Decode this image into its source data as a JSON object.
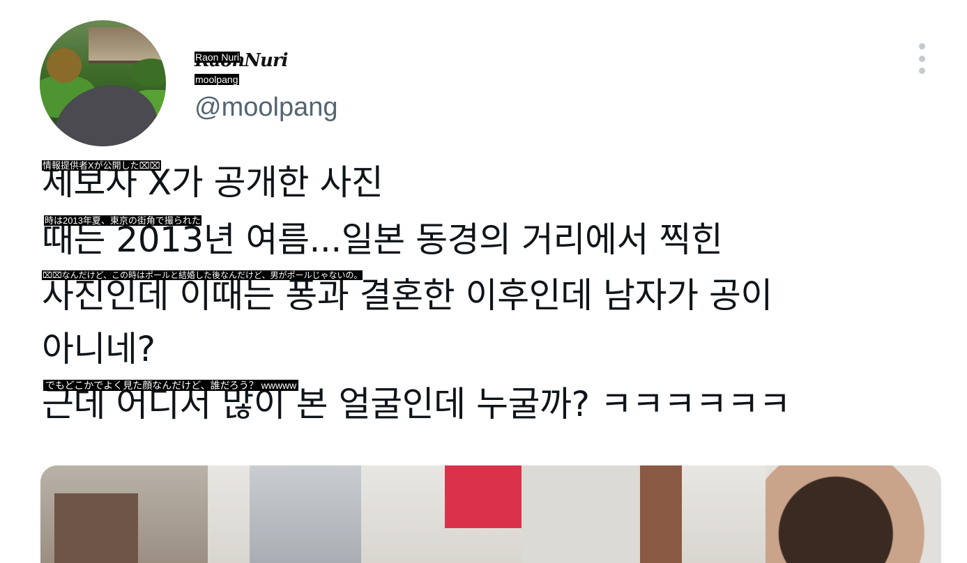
{
  "profile": {
    "avatar_icon": "garden-path-avatar",
    "display_name_script": "RaonNuri",
    "display_name_overlay": "Raon Nuri",
    "handle_overlay": "moolpang",
    "handle": "@moolpang",
    "more_icon": "vertical-ellipsis-icon"
  },
  "tweet": {
    "lines": [
      "제보자 X가 공개한 사진",
      "때는 2013년 여름...일본 동경의 거리에서 찍힌",
      "사진인데 이때는 퐁과 결혼한 이후인데 남자가 공이",
      "아니네?",
      "근데 어디서 많이 본 얼굴인데 누굴까? ㅋㅋㅋㅋㅋㅋ"
    ],
    "translation_overlays": [
      "情報提供者Xが公開した⌧⌧",
      "時は2013年夏、東京の街角で撮られた",
      "⌧⌧なんだけど、この時はポールと結婚した後なんだけど、男がポールじゃないの。",
      "でもどこかでよく見た顔なんだけど、誰だろう？ wwwww"
    ]
  },
  "media": {
    "photo_icon": "street-photo"
  }
}
